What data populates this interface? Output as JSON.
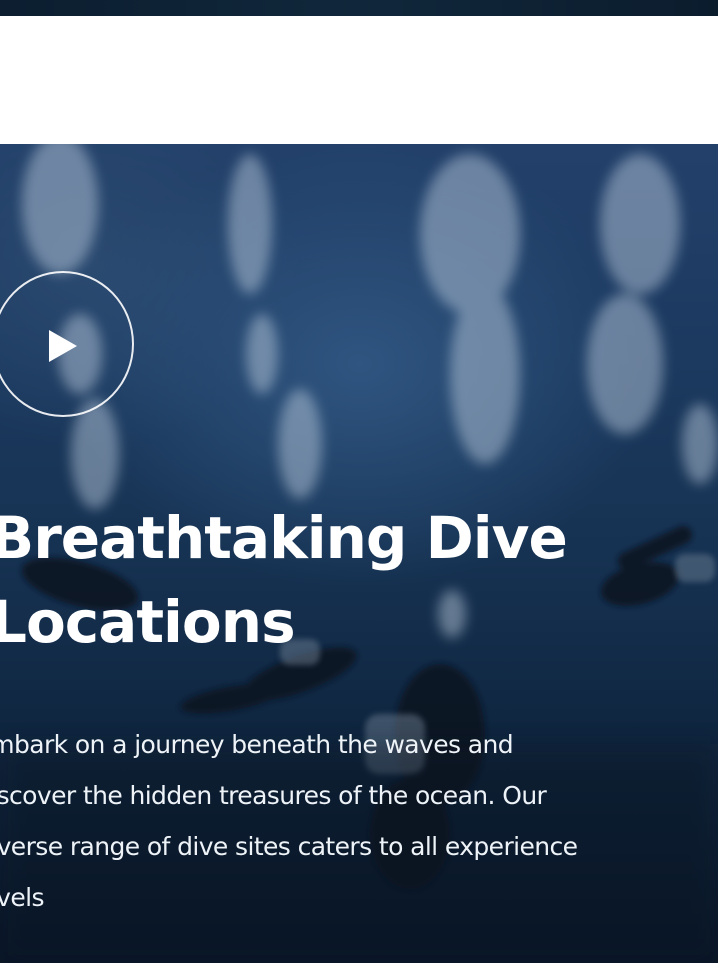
{
  "hero": {
    "title_line1": "Breathtaking Dive",
    "title_line2": "Locations",
    "description_lines": [
      "Embark on a journey beneath the waves and",
      "discover the hidden treasures of the ocean. Our",
      "diverse range of dive sites caters to all experience",
      "levels"
    ],
    "play_icon": "play-icon",
    "image_description": "scuba divers underwater with rising bubbles",
    "colors": {
      "header_background": "#ffffff",
      "water_top": "#22406a",
      "water_bottom": "#081628",
      "text": "#ffffff"
    }
  }
}
